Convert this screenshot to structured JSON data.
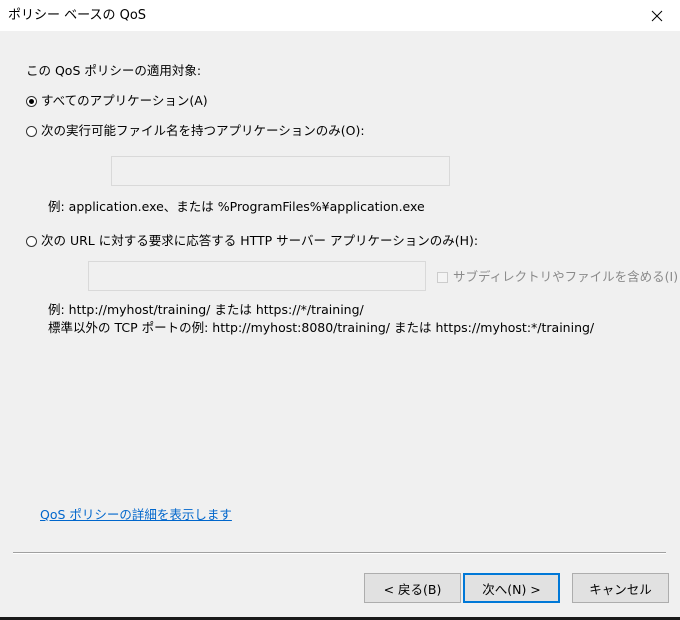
{
  "window": {
    "title": "ポリシー ベースの QoS",
    "close_glyph": "✕"
  },
  "scope": {
    "heading": "この QoS ポリシーの適用対象:",
    "options": [
      {
        "label": "すべてのアプリケーション(A)",
        "checked": true
      },
      {
        "label": "次の実行可能ファイル名を持つアプリケーションのみ(O):",
        "checked": false
      },
      {
        "label": "次の URL に対する要求に応答する HTTP サーバー アプリケーションのみ(H):",
        "checked": false
      }
    ]
  },
  "exe_section": {
    "input_value": "",
    "example": "例:  application.exe、または %ProgramFiles%¥application.exe"
  },
  "url_section": {
    "input_value": "",
    "include_subdirs_label": "サブディレクトリやファイルを含める(I)",
    "include_subdirs_checked": false,
    "example_line1": "例:  http://myhost/training/ または https://*/training/",
    "example_line2": "標準以外の TCP ポートの例:  http://myhost:8080/training/ または https://myhost:*/training/"
  },
  "details_link": "QoS ポリシーの詳細を表示します",
  "buttons": {
    "back": "< 戻る(B)",
    "next": "次へ(N) >",
    "cancel": "キャンセル"
  },
  "colors": {
    "link": "#0066cc",
    "default_button_border": "#0078d7",
    "dialog_background": "#f0f0f0"
  }
}
